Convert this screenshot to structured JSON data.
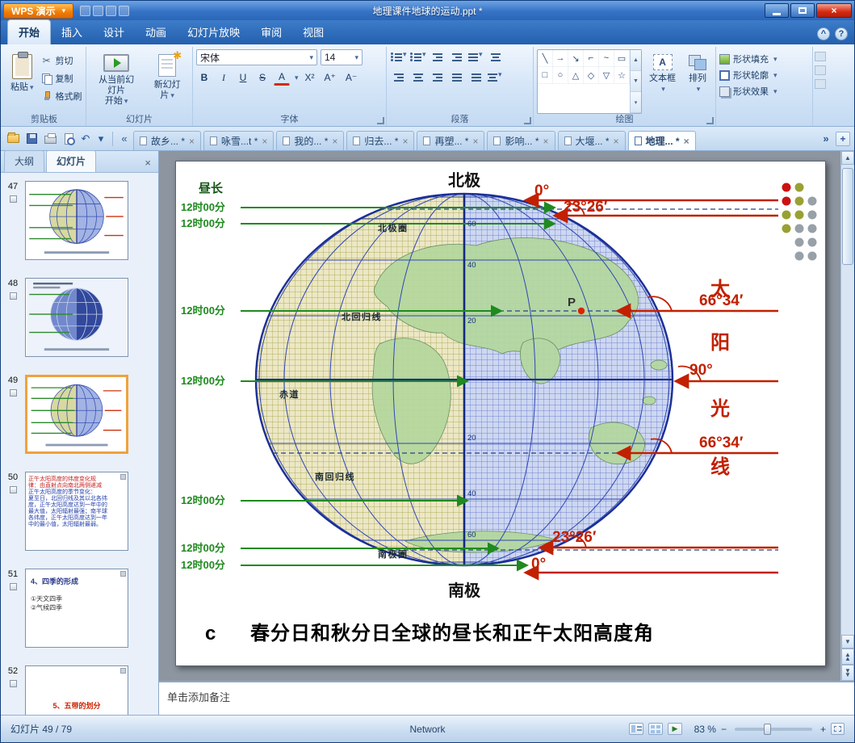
{
  "window": {
    "app_button": "WPS 演示",
    "title": "地理课件地球的运动.ppt *"
  },
  "icons": {
    "caret_down": "▾",
    "close": "×",
    "help": "?",
    "collapse": "^",
    "play": "▶",
    "up": "▲",
    "down": "▼",
    "left": "«",
    "right": "»",
    "plus": "+",
    "minus": "−",
    "undo": "↶",
    "cut": "✂",
    "star": "✱",
    "letter_a": "A"
  },
  "ribbon_tabs": [
    {
      "label": "开始"
    },
    {
      "label": "插入"
    },
    {
      "label": "设计"
    },
    {
      "label": "动画"
    },
    {
      "label": "幻灯片放映"
    },
    {
      "label": "审阅"
    },
    {
      "label": "视图"
    }
  ],
  "ribbon": {
    "paste_label": "粘贴",
    "cut_label": "剪切",
    "copy_label": "复制",
    "format_painter_label": "格式刷",
    "clipboard_group": "剪贴板",
    "from_current_line1": "从当前幻灯片",
    "from_current_line2": "开始",
    "new_slide_label": "新幻灯片",
    "slides_group": "幻灯片",
    "font_name": "宋体",
    "font_size": "14",
    "font_buttons": [
      "B",
      "I",
      "U",
      "S",
      "A",
      "X²",
      "A⁺",
      "A⁻"
    ],
    "font_group": "字体",
    "paragraph_group": "段落",
    "shape_glyphs": [
      "╲",
      "→",
      "↘",
      "⌐",
      "~",
      "▭",
      "□",
      "○",
      "△",
      "◇",
      "▽",
      "☆"
    ],
    "text_box_label": "文本框",
    "arrange_label": "排列",
    "drawing_group": "绘图",
    "shape_fill_label": "形状填充",
    "shape_outline_label": "形状轮廓",
    "shape_effects_label": "形状效果"
  },
  "doc_tabs": [
    "故乡... *",
    "咏雪...t *",
    "我的... *",
    "归去... *",
    "再塑... *",
    "影响... *",
    "大堰... *",
    "地理... *"
  ],
  "sidebar": {
    "outline_tab": "大纲",
    "slides_tab": "幻灯片",
    "thumbs": [
      {
        "number": "47"
      },
      {
        "number": "48"
      },
      {
        "number": "49"
      },
      {
        "number": "50",
        "red_lines": [
          "正午太阳高度的纬度变化规",
          "律：由直射点向南北两侧递减"
        ],
        "blue_lines": [
          "正午太阳高度的季节变化：",
          "夏至日，北回归线及其以北各纬",
          "度，正午太阳高度达到一年中的",
          "最大值，太阳辐射最强；南半球",
          "各纬度，正午太阳高度达到一年",
          "中的最小值，太阳辐射最弱。"
        ]
      },
      {
        "number": "51",
        "title": "4、四季的形成",
        "items": [
          "①天文四季",
          "②气候四季"
        ]
      },
      {
        "number": "52",
        "title": "5、五带的划分"
      }
    ]
  },
  "slide": {
    "north_pole": "北极",
    "south_pole": "南极",
    "day_length": "昼长",
    "time_labels": [
      "12时00分",
      "12时00分",
      "12时00分",
      "12时00分",
      "12时00分",
      "12时00分",
      "12时00分"
    ],
    "angles": [
      "0°",
      "23°26′",
      "66°34′",
      "90°",
      "66°34′",
      "23°26′",
      "0°"
    ],
    "sun_chars": [
      "太",
      "阳",
      "光",
      "线"
    ],
    "point_label": "P",
    "circles": {
      "arctic": "北极圈",
      "tropic_n": "北回归线",
      "equator": "赤道",
      "tropic_s": "南回归线",
      "antarctic": "南极圈"
    },
    "lat_ticks": [
      "60",
      "40",
      "20",
      "20",
      "40",
      "60"
    ],
    "caption_prefix": "c",
    "caption": "春分日和秋分日全球的昼长和正午太阳高度角",
    "dots": [
      [
        "#cc1111",
        "#9aa033"
      ],
      [
        "#cc1111",
        "#9aa033",
        "#98a0a8"
      ],
      [
        "#9aa033",
        "#9aa033",
        "#98a0a8"
      ],
      [
        "#9aa033",
        "#98a0a8",
        "#98a0a8"
      ],
      [
        "#98a0a8",
        "#98a0a8"
      ],
      [
        "#98a0a8",
        "#98a0a8"
      ]
    ],
    "colors": {
      "sun_ray": "#c22000",
      "day_line": "#1f8a1f",
      "grid_blue": "#2f46b4",
      "grid_olive": "#9d9d40"
    }
  },
  "notes": {
    "placeholder": "单击添加备注"
  },
  "status": {
    "slide_counter": "幻灯片 49 / 79",
    "network": "Network",
    "zoom": "83 %"
  }
}
